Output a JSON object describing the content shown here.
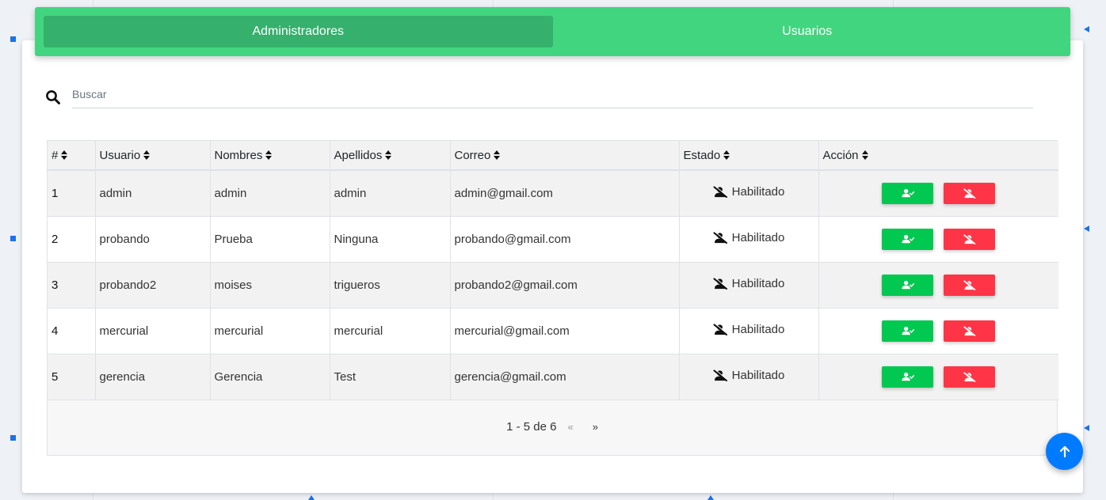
{
  "tabs": [
    {
      "label": "Administradores",
      "active": true
    },
    {
      "label": "Usuarios",
      "active": false
    }
  ],
  "search": {
    "placeholder": "Buscar",
    "value": ""
  },
  "table": {
    "headers": [
      "#",
      "Usuario",
      "Nombres",
      "Apellidos",
      "Correo",
      "Estado",
      "Acción"
    ],
    "rows": [
      {
        "idx": "1",
        "usuario": "admin",
        "nombres": "admin",
        "apellidos": "admin",
        "correo": "admin@gmail.com",
        "estado": "Habilitado"
      },
      {
        "idx": "2",
        "usuario": "probando",
        "nombres": "Prueba",
        "apellidos": "Ninguna",
        "correo": "probando@gmail.com",
        "estado": "Habilitado"
      },
      {
        "idx": "3",
        "usuario": "probando2",
        "nombres": "moises",
        "apellidos": "trigueros",
        "correo": "probando2@gmail.com",
        "estado": "Habilitado"
      },
      {
        "idx": "4",
        "usuario": "mercurial",
        "nombres": "mercurial",
        "apellidos": "mercurial",
        "correo": "mercurial@gmail.com",
        "estado": "Habilitado"
      },
      {
        "idx": "5",
        "usuario": "gerencia",
        "nombres": "Gerencia",
        "apellidos": "Test",
        "correo": "gerencia@gmail.com",
        "estado": "Habilitado"
      }
    ]
  },
  "pagination": {
    "range": "1 - 5 de 6",
    "prev": "«",
    "next": "»"
  },
  "colors": {
    "tab_bar": "#42d580",
    "tab_active": "#35b06d",
    "enable_button": "#00c851",
    "disable_button": "#ff3547",
    "fab": "#007bff"
  },
  "icons": {
    "search": "search-icon",
    "estado": "user-slash-icon",
    "enable": "user-check-icon",
    "disable": "user-slash-icon",
    "fab": "arrow-up-icon",
    "sort": "sort-icon"
  }
}
